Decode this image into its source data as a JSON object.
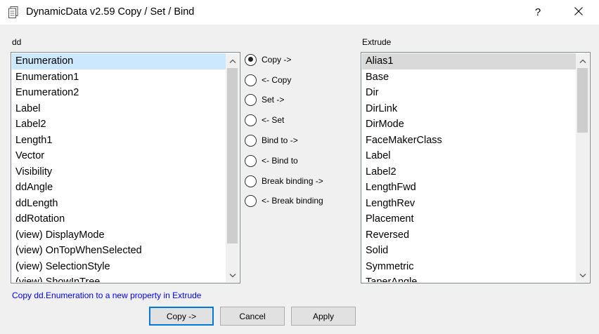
{
  "window": {
    "title": "DynamicData v2.59 Copy / Set / Bind",
    "help_label": "?",
    "icons": {
      "app": "document-icon",
      "close": "close-icon"
    }
  },
  "left_panel": {
    "label": "dd",
    "items": [
      {
        "text": "Enumeration",
        "selected": true
      },
      {
        "text": "Enumeration1"
      },
      {
        "text": "Enumeration2"
      },
      {
        "text": "Label"
      },
      {
        "text": "Label2"
      },
      {
        "text": "Length1"
      },
      {
        "text": "Vector"
      },
      {
        "text": "Visibility"
      },
      {
        "text": "ddAngle"
      },
      {
        "text": "ddLength"
      },
      {
        "text": "ddRotation"
      },
      {
        "text": "(view) DisplayMode"
      },
      {
        "text": "(view) OnTopWhenSelected"
      },
      {
        "text": "(view) SelectionStyle"
      },
      {
        "text": "(view) ShowInTree"
      }
    ]
  },
  "right_panel": {
    "label": "Extrude",
    "items": [
      {
        "text": "Alias1",
        "selected": true
      },
      {
        "text": "Base"
      },
      {
        "text": "Dir"
      },
      {
        "text": "DirLink"
      },
      {
        "text": "DirMode"
      },
      {
        "text": "FaceMakerClass"
      },
      {
        "text": "Label"
      },
      {
        "text": "Label2"
      },
      {
        "text": "LengthFwd"
      },
      {
        "text": "LengthRev"
      },
      {
        "text": "Placement"
      },
      {
        "text": "Reversed"
      },
      {
        "text": "Solid"
      },
      {
        "text": "Symmetric"
      },
      {
        "text": "TaperAngle"
      }
    ]
  },
  "options": [
    {
      "label": "Copy ->",
      "checked": true
    },
    {
      "label": "<- Copy"
    },
    {
      "label": "Set ->"
    },
    {
      "label": "<- Set"
    },
    {
      "label": "Bind to ->"
    },
    {
      "label": "<- Bind to"
    },
    {
      "label": "Break binding ->"
    },
    {
      "label": "<- Break binding"
    }
  ],
  "status": {
    "text": "Copy dd.Enumeration to a new property in Extrude",
    "color": "#0000ee"
  },
  "buttons": {
    "copy": "Copy ->",
    "cancel": "Cancel",
    "apply": "Apply"
  },
  "colors": {
    "accent": "#0078d7",
    "left_selection": "#cce8ff",
    "right_selection": "#d9d9d9"
  }
}
